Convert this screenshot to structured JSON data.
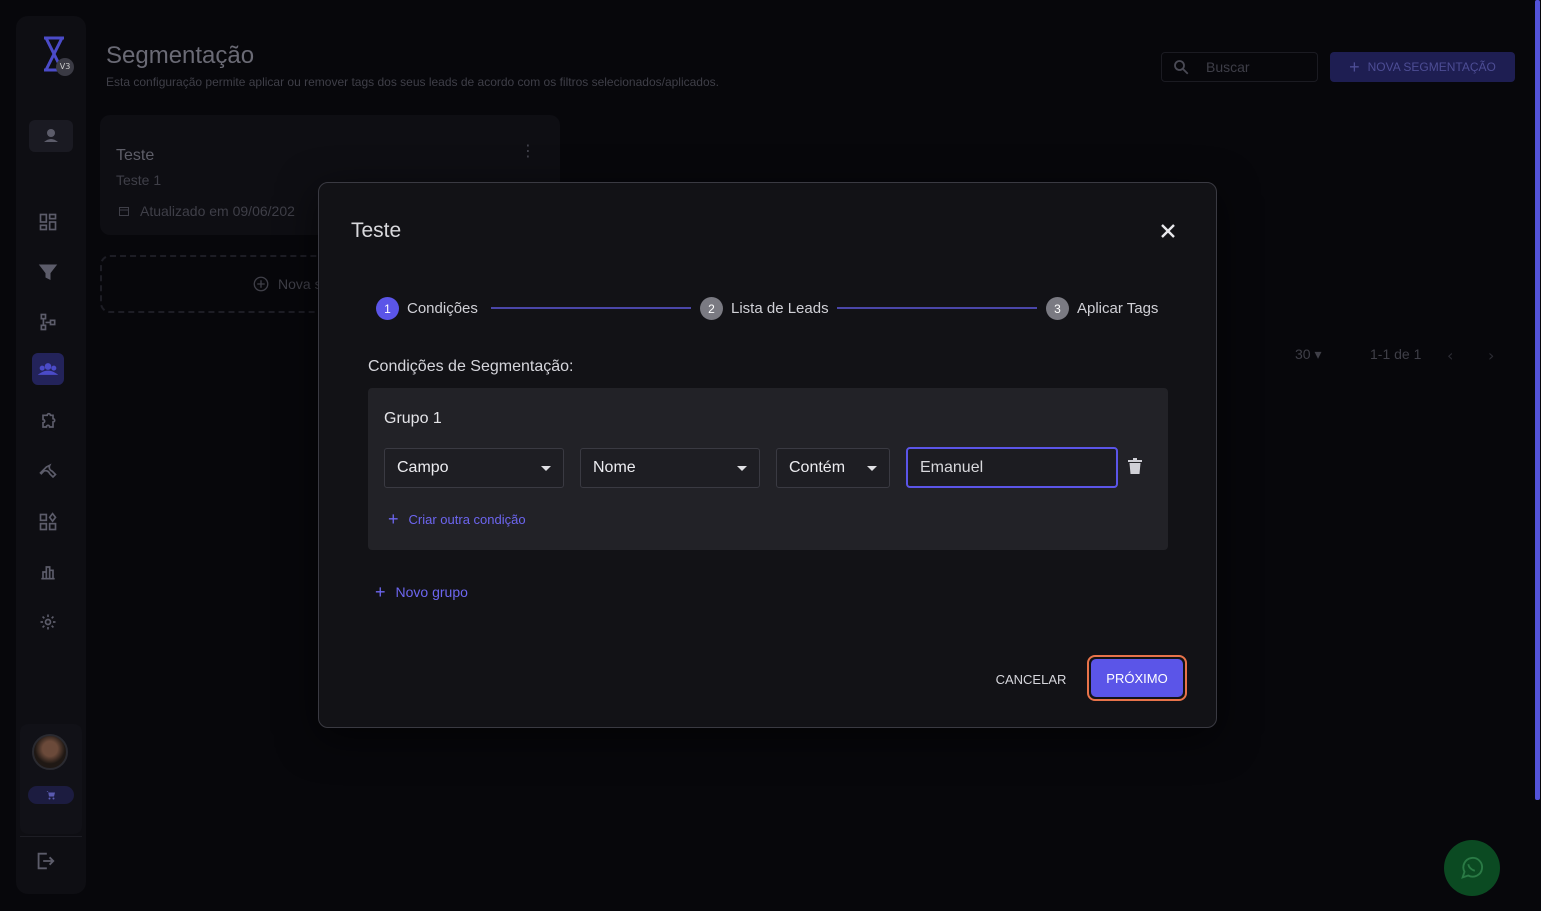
{
  "sidebar": {
    "logo_badge": "V3",
    "icons": [
      "dashboard-icon",
      "filter-icon",
      "flow-icon",
      "segment-icon",
      "puzzle-icon",
      "tool-icon",
      "apps-icon",
      "chart-icon",
      "settings-icon"
    ],
    "active": "segment-icon"
  },
  "header": {
    "title": "Segmentação",
    "subtitle": "Esta configuração permite aplicar ou remover tags dos seus leads de acordo com os filtros selecionados/aplicados.",
    "search_placeholder": "Buscar",
    "new_button": "NOVA SEGMENTAÇÃO"
  },
  "segment_card": {
    "title": "Teste",
    "subtitle": "Teste 1",
    "updated": "Atualizado em 09/06/202"
  },
  "new_segment_placeholder": "Nova s",
  "pagination": {
    "per_page": "30",
    "range": "1-1 de 1"
  },
  "modal": {
    "title": "Teste",
    "steps": [
      {
        "number": "1",
        "label": "Condições"
      },
      {
        "number": "2",
        "label": "Lista de Leads"
      },
      {
        "number": "3",
        "label": "Aplicar Tags"
      }
    ],
    "conditions_label": "Condições de Segmentação:",
    "group": {
      "title": "Grupo 1",
      "field_select": "Campo",
      "attribute_select": "Nome",
      "operator_select": "Contém",
      "value": "Emanuel",
      "add_condition": "Criar outra condição"
    },
    "add_group": "Novo grupo",
    "cancel": "CANCELAR",
    "next": "PRÓXIMO"
  },
  "colors": {
    "accent": "#5b55e8",
    "focus_ring": "#e8734a",
    "background": "#07070b",
    "modal": "#121216"
  }
}
